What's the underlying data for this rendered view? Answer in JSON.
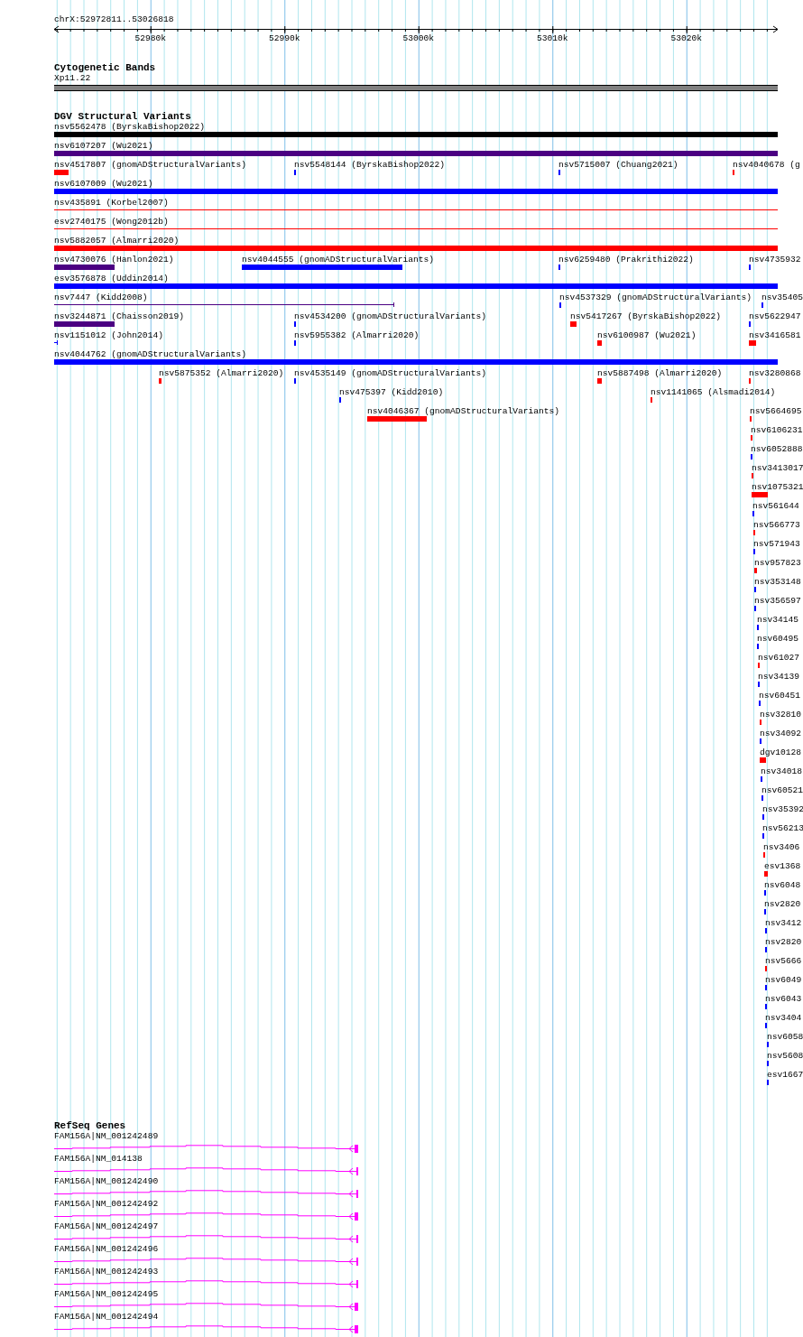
{
  "ruler": {
    "title": "chrX:52972811..53026818",
    "ticks": [
      "52980k",
      "52990k",
      "53000k",
      "53010k",
      "53020k"
    ]
  },
  "cytoband": {
    "title": "Cytogenetic Bands",
    "band": "Xp11.22"
  },
  "dgv": {
    "title": "DGV Structural Variants",
    "rows": [
      {
        "features": [
          {
            "label": "nsv5562478 (ByrskaBishop2022)",
            "color": "#000000",
            "kind": "bar"
          }
        ]
      },
      {
        "features": [
          {
            "label": "nsv6107207 (Wu2021)",
            "color": "#4b0082",
            "kind": "bar"
          }
        ]
      },
      {
        "features": [
          {
            "label": "nsv4517807 (gnomADStructuralVariants)",
            "color": "#ff0000",
            "kind": "bar"
          },
          {
            "label": "nsv5548144 (ByrskaBishop2022)",
            "color": "#0000ff",
            "kind": "bar"
          },
          {
            "label": "nsv5715007 (Chuang2021)",
            "color": "#0000ff",
            "kind": "bar"
          },
          {
            "label": "nsv4040678 (g",
            "color": "#ff0000",
            "kind": "bar"
          }
        ]
      },
      {
        "features": [
          {
            "label": "nsv6107009 (Wu2021)",
            "color": "#0000ff",
            "kind": "bar"
          }
        ]
      },
      {
        "features": [
          {
            "label": "nsv435891 (Korbel2007)",
            "color": "#ff0000",
            "kind": "line"
          }
        ]
      },
      {
        "features": [
          {
            "label": "esv2740175 (Wong2012b)",
            "color": "#ff0000",
            "kind": "line"
          }
        ]
      },
      {
        "features": [
          {
            "label": "nsv5882057 (Almarri2020)",
            "color": "#ff0000",
            "kind": "bar"
          }
        ]
      },
      {
        "features": [
          {
            "label": "nsv4730076 (Hanlon2021)",
            "color": "#4b0082",
            "kind": "bar"
          },
          {
            "label": "nsv4044555 (gnomADStructuralVariants)",
            "color": "#0000ff",
            "kind": "bar"
          },
          {
            "label": "nsv6259480 (Prakrithi2022)",
            "color": "#0000ff",
            "kind": "bar"
          },
          {
            "label": "nsv4735932",
            "color": "#0000ff",
            "kind": "bar"
          }
        ]
      },
      {
        "features": [
          {
            "label": "esv3576878 (Uddin2014)",
            "color": "#0000ff",
            "kind": "bar"
          }
        ]
      },
      {
        "features": [
          {
            "label": "nsv7447 (Kidd2008)",
            "color": "#4b0082",
            "kind": "line"
          },
          {
            "label": "nsv4537329 (gnomADStructuralVariants)",
            "color": "#0000ff",
            "kind": "bar"
          },
          {
            "label": "nsv35405",
            "color": "#0000ff",
            "kind": "bar"
          }
        ]
      },
      {
        "features": [
          {
            "label": "nsv3244871 (Chaisson2019)",
            "color": "#4b0082",
            "kind": "bar"
          },
          {
            "label": "nsv4534200 (gnomADStructuralVariants)",
            "color": "#0000ff",
            "kind": "bar"
          },
          {
            "label": "nsv5417267 (ByrskaBishop2022)",
            "color": "#ff0000",
            "kind": "bar"
          },
          {
            "label": "nsv5622947",
            "color": "#0000ff",
            "kind": "bar"
          }
        ]
      },
      {
        "features": [
          {
            "label": "nsv1151012 (John2014)",
            "color": "#0000ff",
            "kind": "line"
          },
          {
            "label": "nsv5955382 (Almarri2020)",
            "color": "#0000ff",
            "kind": "bar"
          },
          {
            "label": "nsv6100987 (Wu2021)",
            "color": "#ff0000",
            "kind": "bar"
          },
          {
            "label": "nsv3416581",
            "color": "#ff0000",
            "kind": "bar"
          }
        ]
      },
      {
        "features": [
          {
            "label": "nsv4044762 (gnomADStructuralVariants)",
            "color": "#0000ff",
            "kind": "bar"
          }
        ]
      },
      {
        "features": [
          {
            "label": "nsv5875352 (Almarri2020)",
            "color": "#ff0000",
            "kind": "bar"
          },
          {
            "label": "nsv4535149 (gnomADStructuralVariants)",
            "color": "#0000ff",
            "kind": "bar"
          },
          {
            "label": "nsv5887498 (Almarri2020)",
            "color": "#ff0000",
            "kind": "bar"
          },
          {
            "label": "nsv3280868",
            "color": "#ff0000",
            "kind": "bar"
          }
        ]
      },
      {
        "features": [
          {
            "label": "nsv475397 (Kidd2010)",
            "color": "#0000ff",
            "kind": "bar"
          },
          {
            "label": "nsv1141065 (Alsmadi2014)",
            "color": "#ff0000",
            "kind": "bar"
          }
        ]
      },
      {
        "features": [
          {
            "label": "nsv4046367 (gnomADStructuralVariants)",
            "color": "#ff0000",
            "kind": "bar"
          },
          {
            "label": "nsv5664695",
            "color": "#ff0000",
            "kind": "bar"
          }
        ]
      },
      {
        "features": [
          {
            "label": "nsv6106231",
            "color": "#ff0000",
            "kind": "bar"
          }
        ]
      },
      {
        "features": [
          {
            "label": "nsv6052888",
            "color": "#0000ff",
            "kind": "bar"
          }
        ]
      },
      {
        "features": [
          {
            "label": "nsv3413017",
            "color": "#ff0000",
            "kind": "bar"
          }
        ]
      },
      {
        "features": [
          {
            "label": "nsv1075321",
            "color": "#ff0000",
            "kind": "bar"
          }
        ]
      },
      {
        "features": [
          {
            "label": "nsv561644",
            "color": "#0000ff",
            "kind": "bar"
          }
        ]
      },
      {
        "features": [
          {
            "label": "nsv566773",
            "color": "#ff0000",
            "kind": "bar"
          }
        ]
      },
      {
        "features": [
          {
            "label": "nsv571943",
            "color": "#0000ff",
            "kind": "bar"
          }
        ]
      },
      {
        "features": [
          {
            "label": "nsv957823",
            "color": "#ff0000",
            "kind": "bar"
          }
        ]
      },
      {
        "features": [
          {
            "label": "nsv353148",
            "color": "#0000ff",
            "kind": "bar"
          }
        ]
      },
      {
        "features": [
          {
            "label": "nsv356597",
            "color": "#0000ff",
            "kind": "bar"
          }
        ]
      },
      {
        "features": [
          {
            "label": "nsv34145",
            "color": "#0000ff",
            "kind": "bar"
          }
        ]
      },
      {
        "features": [
          {
            "label": "nsv60495",
            "color": "#0000ff",
            "kind": "bar"
          }
        ]
      },
      {
        "features": [
          {
            "label": "nsv61027",
            "color": "#ff0000",
            "kind": "bar"
          }
        ]
      },
      {
        "features": [
          {
            "label": "nsv34139",
            "color": "#0000ff",
            "kind": "bar"
          }
        ]
      },
      {
        "features": [
          {
            "label": "nsv60451",
            "color": "#0000ff",
            "kind": "bar"
          }
        ]
      },
      {
        "features": [
          {
            "label": "nsv32810",
            "color": "#ff0000",
            "kind": "bar"
          }
        ]
      },
      {
        "features": [
          {
            "label": "nsv34092",
            "color": "#0000ff",
            "kind": "bar"
          }
        ]
      },
      {
        "features": [
          {
            "label": "dgv10128",
            "color": "#ff0000",
            "kind": "bar"
          }
        ]
      },
      {
        "features": [
          {
            "label": "nsv34018",
            "color": "#0000ff",
            "kind": "bar"
          }
        ]
      },
      {
        "features": [
          {
            "label": "nsv60521",
            "color": "#0000ff",
            "kind": "bar"
          }
        ]
      },
      {
        "features": [
          {
            "label": "nsv35392",
            "color": "#0000ff",
            "kind": "bar"
          }
        ]
      },
      {
        "features": [
          {
            "label": "nsv56213",
            "color": "#0000ff",
            "kind": "bar"
          }
        ]
      },
      {
        "features": [
          {
            "label": "nsv3406",
            "color": "#ff0000",
            "kind": "bar"
          }
        ]
      },
      {
        "features": [
          {
            "label": "esv1368",
            "color": "#ff0000",
            "kind": "bar"
          }
        ]
      },
      {
        "features": [
          {
            "label": "nsv6048",
            "color": "#0000ff",
            "kind": "bar"
          }
        ]
      },
      {
        "features": [
          {
            "label": "nsv2820",
            "color": "#0000ff",
            "kind": "bar"
          }
        ]
      },
      {
        "features": [
          {
            "label": "nsv3412",
            "color": "#0000ff",
            "kind": "bar"
          }
        ]
      },
      {
        "features": [
          {
            "label": "nsv2820",
            "color": "#0000ff",
            "kind": "bar"
          }
        ]
      },
      {
        "features": [
          {
            "label": "nsv5666",
            "color": "#ff0000",
            "kind": "bar"
          }
        ]
      },
      {
        "features": [
          {
            "label": "nsv6049",
            "color": "#0000ff",
            "kind": "bar"
          }
        ]
      },
      {
        "features": [
          {
            "label": "nsv6043",
            "color": "#0000ff",
            "kind": "bar"
          }
        ]
      },
      {
        "features": [
          {
            "label": "nsv3404",
            "color": "#0000ff",
            "kind": "bar"
          }
        ]
      },
      {
        "features": [
          {
            "label": "nsv6058",
            "color": "#0000ff",
            "kind": "bar"
          }
        ]
      },
      {
        "features": [
          {
            "label": "nsv5608",
            "color": "#0000ff",
            "kind": "bar"
          }
        ]
      },
      {
        "features": [
          {
            "label": "esv1667",
            "color": "#0000ff",
            "kind": "bar"
          }
        ]
      }
    ]
  },
  "genes": {
    "title": "RefSeq Genes",
    "transcripts": [
      {
        "label": "FAM156A|NM_001242489",
        "kind": "block"
      },
      {
        "label": "FAM156A|NM_014138",
        "kind": "tick"
      },
      {
        "label": "FAM156A|NM_001242490",
        "kind": "tick"
      },
      {
        "label": "FAM156A|NM_001242492",
        "kind": "block"
      },
      {
        "label": "FAM156A|NM_001242497",
        "kind": "tick"
      },
      {
        "label": "FAM156A|NM_001242496",
        "kind": "tick"
      },
      {
        "label": "FAM156A|NM_001242493",
        "kind": "tick"
      },
      {
        "label": "FAM156A|NM_001242495",
        "kind": "block"
      },
      {
        "label": "FAM156A|NM_001242494",
        "kind": "block"
      }
    ]
  }
}
